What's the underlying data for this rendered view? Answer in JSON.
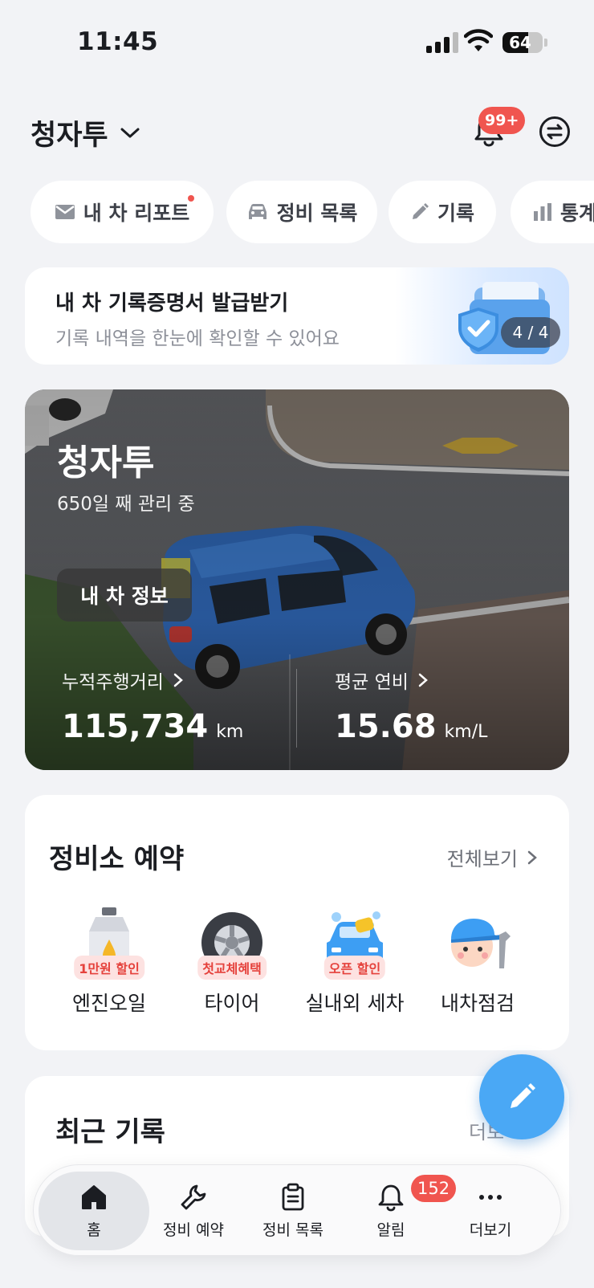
{
  "status_bar": {
    "time": "11:45",
    "battery": "64",
    "battery_level": 0.64
  },
  "header": {
    "car_name": "청자투",
    "notification_badge": "99+"
  },
  "quick_chips": [
    {
      "label": "내 차 리포트",
      "icon": "mail-icon",
      "has_dot": true
    },
    {
      "label": "정비 목록",
      "icon": "car-icon"
    },
    {
      "label": "기록",
      "icon": "pencil-icon"
    },
    {
      "label": "통계",
      "icon": "bar-chart-icon"
    }
  ],
  "banner": {
    "title": "내 차 기록증명서 발급받기",
    "subtitle": "기록 내역을 한눈에 확인할 수 있어요",
    "page": "4 / 4"
  },
  "car_card": {
    "name": "청자투",
    "days": "650일 째 관리 중",
    "info_button": "내 차 정보",
    "mileage": {
      "label": "누적주행거리",
      "value": "115,734",
      "unit": "km"
    },
    "fuel": {
      "label": "평균 연비",
      "value": "15.68",
      "unit": "km/L"
    }
  },
  "shop": {
    "title": "정비소 예약",
    "see_all": "전체보기",
    "services": [
      {
        "label": "엔진오일",
        "badge": "1만원 할인",
        "icon": "engine-oil-icon"
      },
      {
        "label": "타이어",
        "badge": "첫교체혜택",
        "icon": "tire-icon"
      },
      {
        "label": "실내외 세차",
        "badge": "오픈 할인",
        "icon": "car-wash-icon"
      },
      {
        "label": "내차점검",
        "badge": "",
        "icon": "mechanic-icon"
      }
    ]
  },
  "recent": {
    "title": "최근 기록",
    "more": "더보"
  },
  "tabs": [
    {
      "label": "홈",
      "icon": "home-icon",
      "active": true
    },
    {
      "label": "정비 예약",
      "icon": "wrench-icon"
    },
    {
      "label": "정비 목록",
      "icon": "clipboard-icon"
    },
    {
      "label": "알림",
      "icon": "bell-icon",
      "badge": "152"
    },
    {
      "label": "더보기",
      "icon": "more-icon"
    }
  ],
  "colors": {
    "accent": "#4aa8f5",
    "badge_red": "#f0554f",
    "background": "#f2f3f6"
  }
}
